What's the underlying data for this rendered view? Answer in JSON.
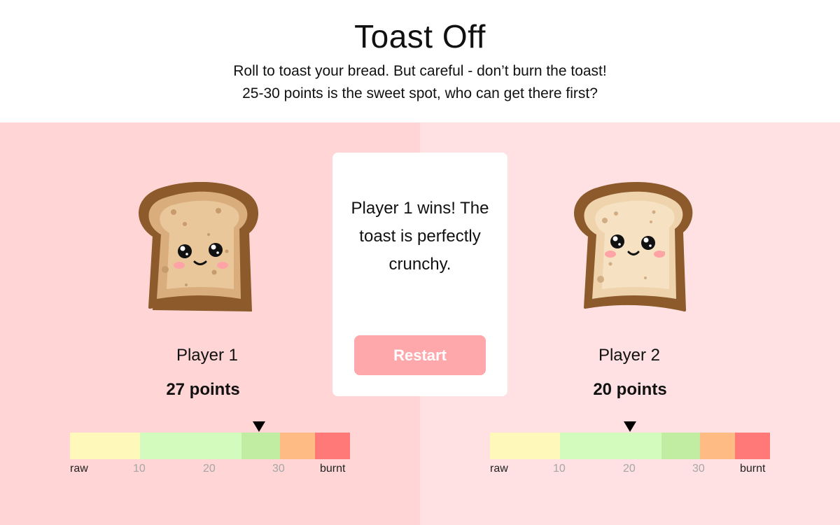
{
  "header": {
    "title": "Toast Off",
    "subtitle_line1": "Roll to toast your bread. But careful - don’t burn the toast!",
    "subtitle_line2": "25-30 points is the sweet spot, who can get there first?"
  },
  "players": [
    {
      "name": "Player 1",
      "points_label": "27 points",
      "score": 27,
      "toast": "toasted-bread-icon"
    },
    {
      "name": "Player 2",
      "points_label": "20 points",
      "score": 20,
      "toast": "light-bread-icon"
    }
  ],
  "meter": {
    "ticks": [
      "raw",
      "10",
      "20",
      "30",
      "burnt"
    ],
    "zones": [
      "raw",
      "toasting",
      "sweet-spot",
      "overdone",
      "burnt"
    ],
    "colors": {
      "raw": "#fef8bb",
      "toasting": "#d3fbbd",
      "sweet": "#c0eda2",
      "overdone": "#ffbb84",
      "burnt": "#ff7979"
    }
  },
  "modal": {
    "message": "Player 1 wins! The toast is perfectly crunchy.",
    "restart_label": "Restart"
  },
  "colors": {
    "panel_left": "#ffd5d6",
    "panel_right": "#ffe1e3",
    "button": "#ffa8ab"
  }
}
